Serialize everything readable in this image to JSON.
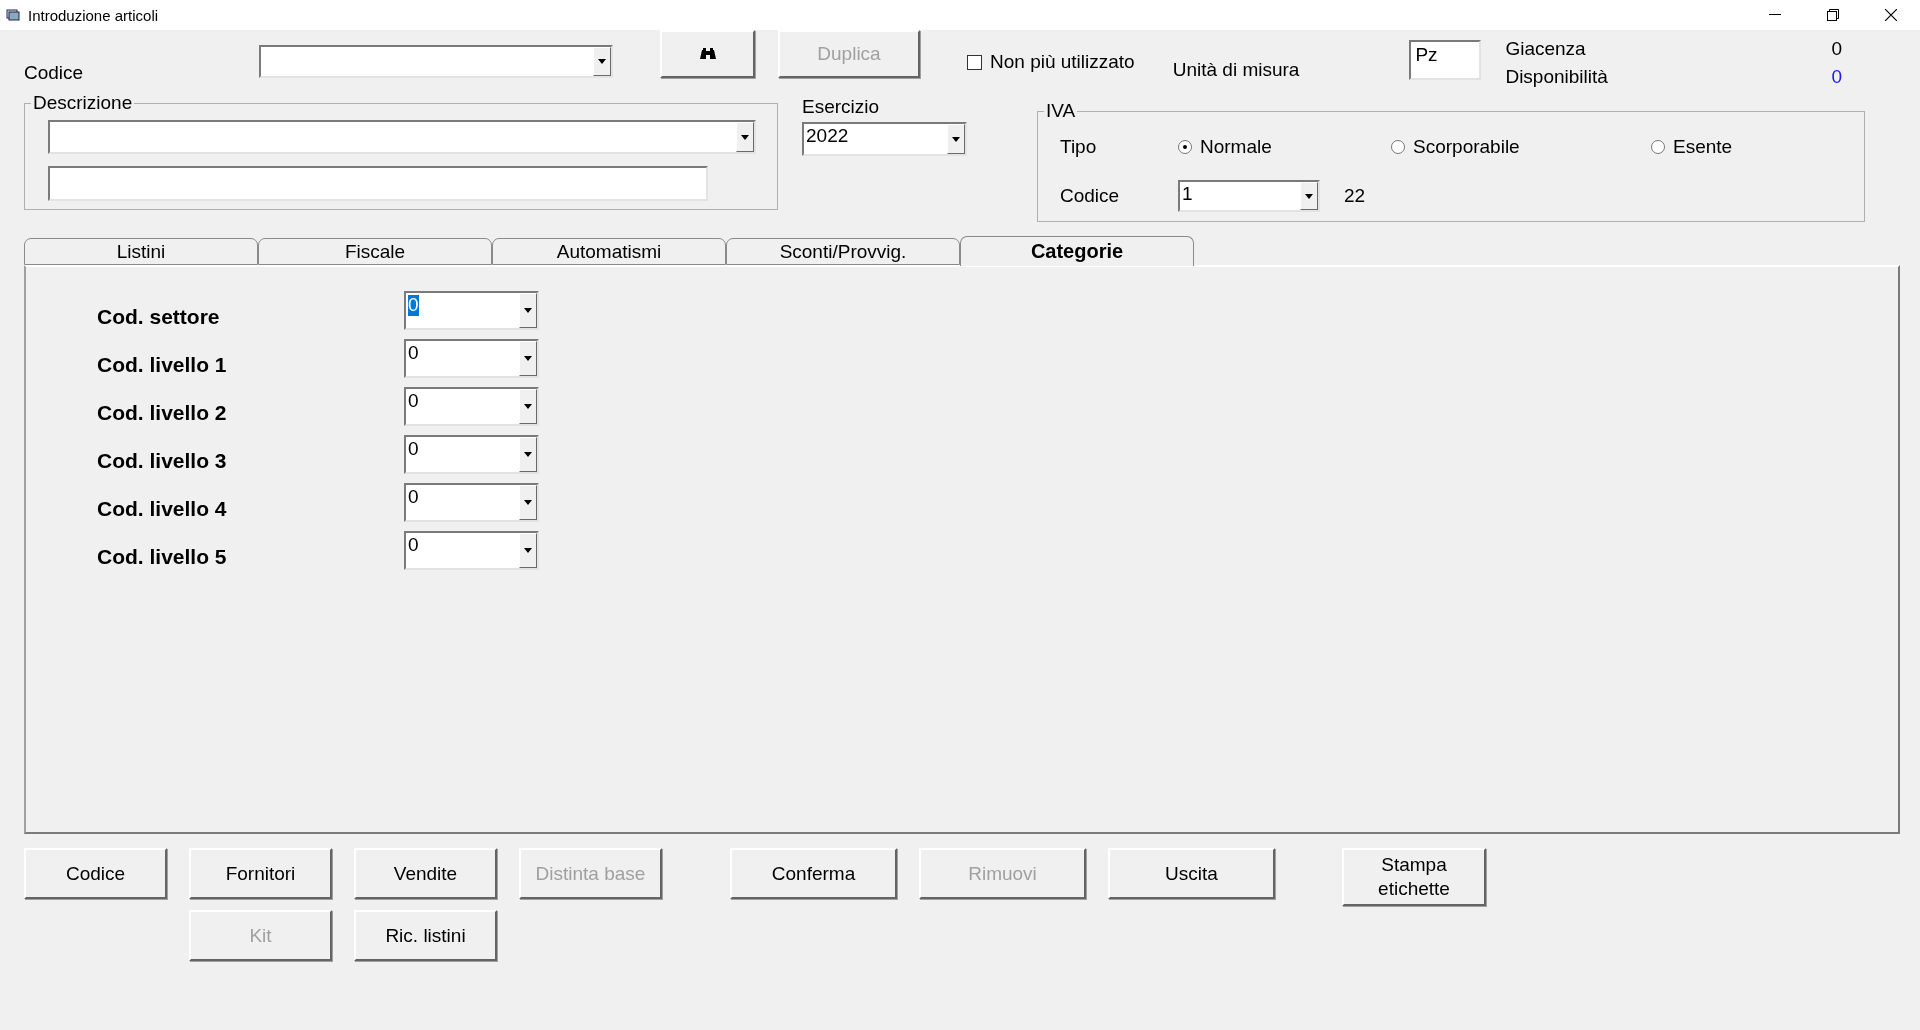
{
  "window": {
    "title": "Introduzione articoli"
  },
  "codice": {
    "label": "Codice"
  },
  "duplica_button": {
    "label": "Duplica",
    "disabled": true
  },
  "non_piu_utilizzato": {
    "label": "Non più utilizzato",
    "checked": false
  },
  "unita_di_misura": {
    "label": "Unità di misura",
    "value": "Pz"
  },
  "giacenza": {
    "label": "Giacenza",
    "value": "0"
  },
  "disponibilita": {
    "label": "Disponibilità",
    "value": "0"
  },
  "descrizione": {
    "label": "Descrizione"
  },
  "esercizio": {
    "label": "Esercizio",
    "value": "2022"
  },
  "iva": {
    "title": "IVA",
    "tipo_label": "Tipo",
    "options": [
      {
        "label": "Normale",
        "selected": true
      },
      {
        "label": "Scorporabile",
        "selected": false
      },
      {
        "label": "Esente",
        "selected": false
      }
    ],
    "codice_label": "Codice",
    "codice_value": "1",
    "aliquota": "22"
  },
  "tabs": [
    {
      "label": "Listini",
      "selected": false
    },
    {
      "label": "Fiscale",
      "selected": false
    },
    {
      "label": "Automatismi",
      "selected": false
    },
    {
      "label": "Sconti/Provvig.",
      "selected": false
    },
    {
      "label": "Categorie",
      "selected": true
    }
  ],
  "categories": [
    {
      "label": "Cod. settore",
      "value": "0",
      "focused": true
    },
    {
      "label": "Cod. livello 1",
      "value": "0",
      "focused": false
    },
    {
      "label": "Cod. livello 2",
      "value": "0",
      "focused": false
    },
    {
      "label": "Cod. livello 3",
      "value": "0",
      "focused": false
    },
    {
      "label": "Cod. livello 4",
      "value": "0",
      "focused": false
    },
    {
      "label": "Cod. livello 5",
      "value": "0",
      "focused": false
    }
  ],
  "buttons": [
    {
      "label": "Codice",
      "disabled": false
    },
    {
      "label": "Fornitori",
      "disabled": false
    },
    {
      "label": "Vendite",
      "disabled": false
    },
    {
      "label": "Distinta base",
      "disabled": true
    },
    {
      "label": "Conferma",
      "disabled": false
    },
    {
      "label": "Rimuovi",
      "disabled": true
    },
    {
      "label": "Uscita",
      "disabled": false
    },
    {
      "label": "Stampa etichette",
      "disabled": false
    }
  ],
  "buttons_row_2": [
    {
      "label": "Kit",
      "disabled": true
    },
    {
      "label": "Ric. listini",
      "disabled": false
    }
  ]
}
